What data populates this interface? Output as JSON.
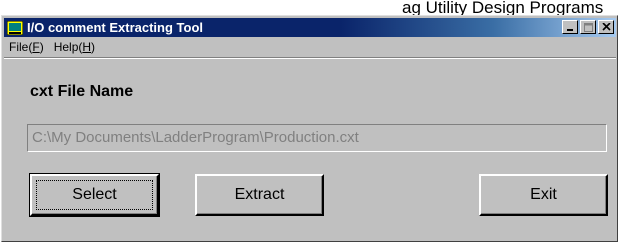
{
  "caption_text": "ag Utility Design Programs",
  "window": {
    "title": "I/O comment Extracting Tool",
    "controls": [
      "minimize-icon",
      "maximize-icon",
      "close-icon"
    ]
  },
  "menu": {
    "file": {
      "label": "File(",
      "key": "F",
      "close": ")"
    },
    "help": {
      "label": "Help(",
      "key": "H",
      "close": ")"
    }
  },
  "form": {
    "label": "cxt File Name",
    "path_value": "C:\\My Documents\\LadderProgram\\Production.cxt"
  },
  "buttons": {
    "select": "Select",
    "extract": "Extract",
    "exit": "Exit"
  },
  "colors": {
    "face": "#c0c0c0",
    "title_active": "#0a246a",
    "disabled_text": "#808080"
  }
}
